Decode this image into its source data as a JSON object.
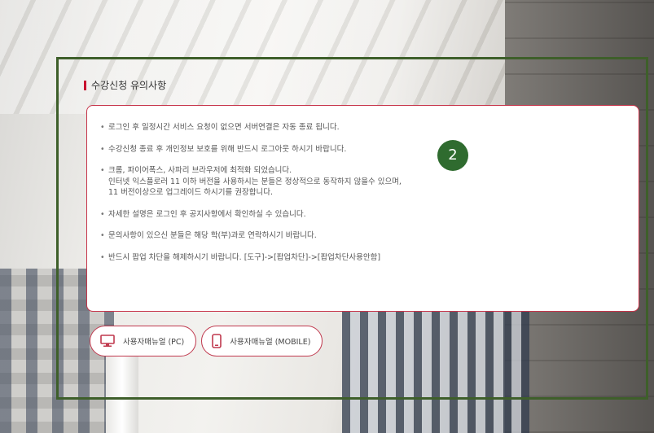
{
  "section": {
    "title": "수강신청 유의사항"
  },
  "notices": [
    {
      "lines": [
        "로그인 후 일정시간 서비스 요청이 없으면 서버연결은 자동 종료 됩니다."
      ]
    },
    {
      "lines": [
        "수강신청 종료 후 개인정보 보호를 위해 반드시 로그아웃 하시기 바랍니다."
      ]
    },
    {
      "lines": [
        "크롬, 파이어폭스, 사파리 브라우저에 최적화 되었습니다.",
        "인터넷 익스플로러 11 이하 버전을 사용하시는 분들은 정상적으로 동작하지 않을수 있으며,",
        "11 버전이상으로 업그레이드 하시기를 권장합니다."
      ]
    },
    {
      "lines": [
        "자세한 설명은 로그인 후 공지사항에서 확인하실 수 있습니다."
      ]
    },
    {
      "lines": [
        "문의사항이 있으신 분들은 해당 학(부)과로 연락하시기 바랍니다."
      ]
    },
    {
      "lines": [
        "반드시 팝업 차단을 해제하시기 바랍니다. [도구]->[팝업차단]->[팝업차단사용안함]"
      ]
    }
  ],
  "buttons": {
    "pc": {
      "label": "사용자매뉴얼 (PC)",
      "icon": "monitor-icon"
    },
    "mobile": {
      "label": "사용자매뉴얼 (MOBILE)",
      "icon": "smartphone-icon"
    }
  },
  "annotation": {
    "marker": "2",
    "frame_color": "#3e5f2a",
    "marker_color": "#2f6b2f"
  },
  "colors": {
    "accent": "#c8102e",
    "button_border": "#c0394e"
  }
}
